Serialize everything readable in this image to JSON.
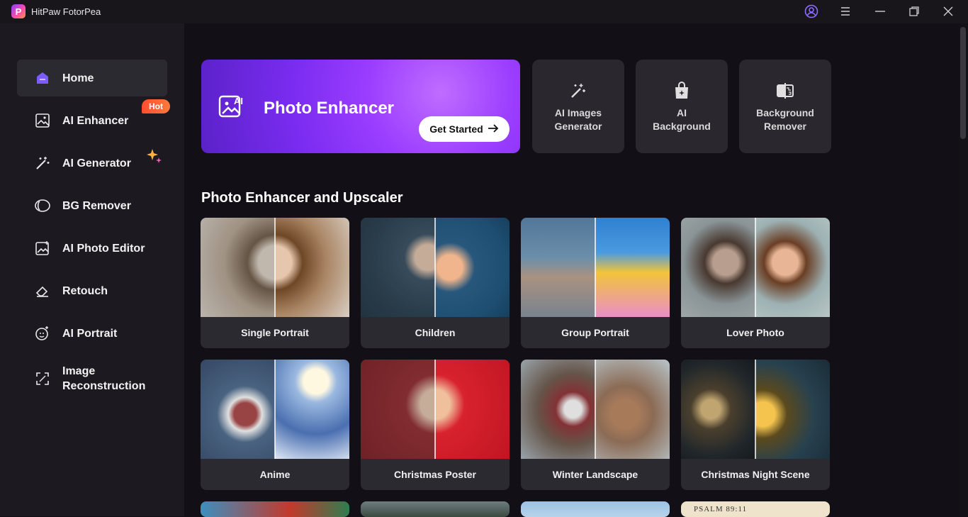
{
  "window": {
    "app_title": "HitPaw FotorPea",
    "logo_letter": "P"
  },
  "sidebar": {
    "items": [
      {
        "label": "Home",
        "icon": "home-icon"
      },
      {
        "label": "AI Enhancer",
        "icon": "image-enhance-icon"
      },
      {
        "label": "AI Generator",
        "icon": "magic-wand-icon"
      },
      {
        "label": "BG Remover",
        "icon": "bg-remove-icon"
      },
      {
        "label": "AI Photo Editor",
        "icon": "photo-edit-icon"
      },
      {
        "label": "Retouch",
        "icon": "eraser-icon"
      },
      {
        "label": "AI Portrait",
        "icon": "portrait-icon"
      },
      {
        "label": "Image\nReconstruction",
        "icon": "expand-icon"
      }
    ],
    "hot_badge": "Hot",
    "active_index": 0
  },
  "hero": {
    "title": "Photo Enhancer",
    "button_label": "Get Started",
    "icon": "ai-image-icon"
  },
  "tools": [
    {
      "label": "AI Images\nGenerator",
      "icon": "magic-wand-icon"
    },
    {
      "label": "AI\nBackground",
      "icon": "bag-sparkle-icon"
    },
    {
      "label": "Background\nRemover",
      "icon": "bg-remove-icon"
    }
  ],
  "section": {
    "title": "Photo Enhancer and Upscaler"
  },
  "cards": [
    {
      "label": "Single Portrait"
    },
    {
      "label": "Children"
    },
    {
      "label": "Group Portrait"
    },
    {
      "label": "Lover Photo"
    },
    {
      "label": "Anime"
    },
    {
      "label": "Christmas Poster"
    },
    {
      "label": "Winter Landscape"
    },
    {
      "label": "Christmas Night Scene"
    }
  ],
  "partial_card_text": "PSALM 89:11",
  "colors": {
    "accent_purple": "#8a3cff",
    "hot_badge": "#ff5a33",
    "sidebar_bg": "#1c1a20",
    "main_bg": "#121016"
  }
}
